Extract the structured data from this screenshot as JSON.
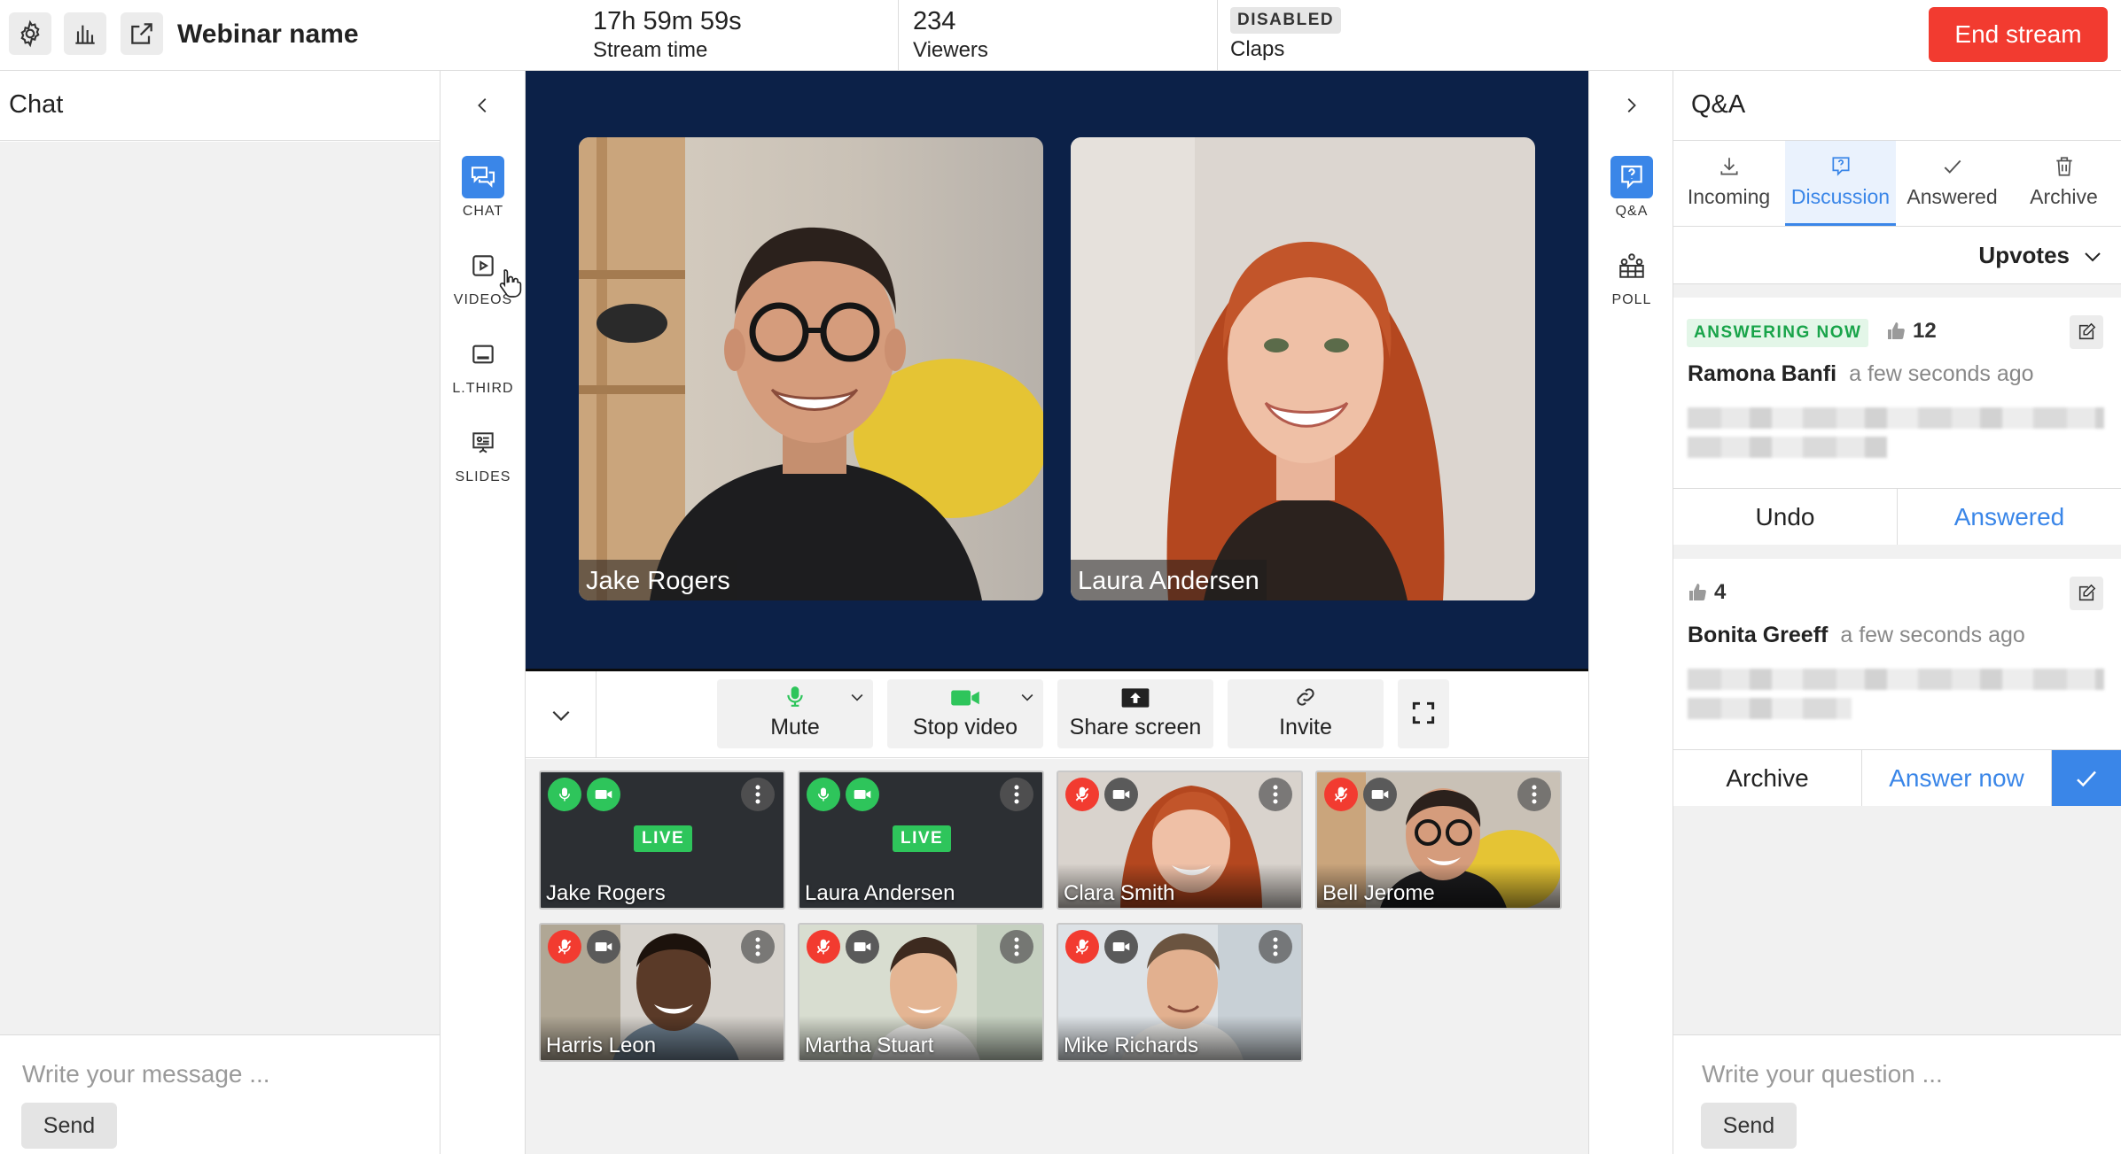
{
  "topbar": {
    "icons": [
      "gear-icon",
      "bar-chart-icon",
      "external-link-icon"
    ],
    "title": "Webinar name",
    "stats": {
      "stream_time_value": "17h 59m 59s",
      "stream_time_label": "Stream time",
      "viewers_value": "234",
      "viewers_label": "Viewers",
      "claps_badge": "DISABLED",
      "claps_label": "Claps"
    },
    "end_button": "End stream",
    "colors": {
      "end_button": "#f23b30"
    }
  },
  "chat": {
    "title": "Chat",
    "placeholder": "Write your message ...",
    "send": "Send"
  },
  "left_rail": {
    "items": [
      {
        "label": "CHAT",
        "icon": "chat-bubbles-icon",
        "active": true
      },
      {
        "label": "VIDEOS",
        "icon": "video-play-icon"
      },
      {
        "label": "L.THIRD",
        "icon": "lower-third-icon"
      },
      {
        "label": "SLIDES",
        "icon": "slides-icon"
      }
    ]
  },
  "stage": {
    "speakers": [
      {
        "name": "Jake Rogers"
      },
      {
        "name": "Laura Andersen"
      }
    ],
    "background": "#0c2148"
  },
  "controls": {
    "mute": "Mute",
    "stop_video": "Stop video",
    "share_screen": "Share screen",
    "invite": "Invite"
  },
  "participants": [
    {
      "name": "Jake Rogers",
      "live": "LIVE",
      "mic": "on",
      "cam": "on"
    },
    {
      "name": "Laura Andersen",
      "live": "LIVE",
      "mic": "on",
      "cam": "on"
    },
    {
      "name": "Clara Smith",
      "mic": "off",
      "cam": "on"
    },
    {
      "name": "Bell Jerome",
      "mic": "off",
      "cam": "on"
    },
    {
      "name": "Harris Leon",
      "mic": "off",
      "cam": "on"
    },
    {
      "name": "Martha Stuart",
      "mic": "off",
      "cam": "on"
    },
    {
      "name": "Mike Richards",
      "mic": "off",
      "cam": "on"
    }
  ],
  "right_rail": {
    "items": [
      {
        "label": "Q&A",
        "icon": "qa-icon",
        "active": true
      },
      {
        "label": "POLL",
        "icon": "poll-icon"
      }
    ]
  },
  "qa": {
    "title": "Q&A",
    "tabs": [
      {
        "label": "Incoming",
        "icon": "download-icon"
      },
      {
        "label": "Discussion",
        "icon": "question-bubble-icon",
        "active": true
      },
      {
        "label": "Answered",
        "icon": "check-icon"
      },
      {
        "label": "Archive",
        "icon": "trash-icon"
      }
    ],
    "sort_label": "Upvotes",
    "questions": [
      {
        "badge": "ANSWERING NOW",
        "votes": "12",
        "author": "Ramona Banfi",
        "time": "a few seconds ago",
        "actions": [
          "Undo",
          "Answered"
        ]
      },
      {
        "votes": "4",
        "author": "Bonita Greeff",
        "time": "a few seconds ago",
        "actions": [
          "Archive",
          "Answer now"
        ]
      }
    ],
    "placeholder": "Write your question ...",
    "send": "Send",
    "accent": "#3a86e8"
  }
}
